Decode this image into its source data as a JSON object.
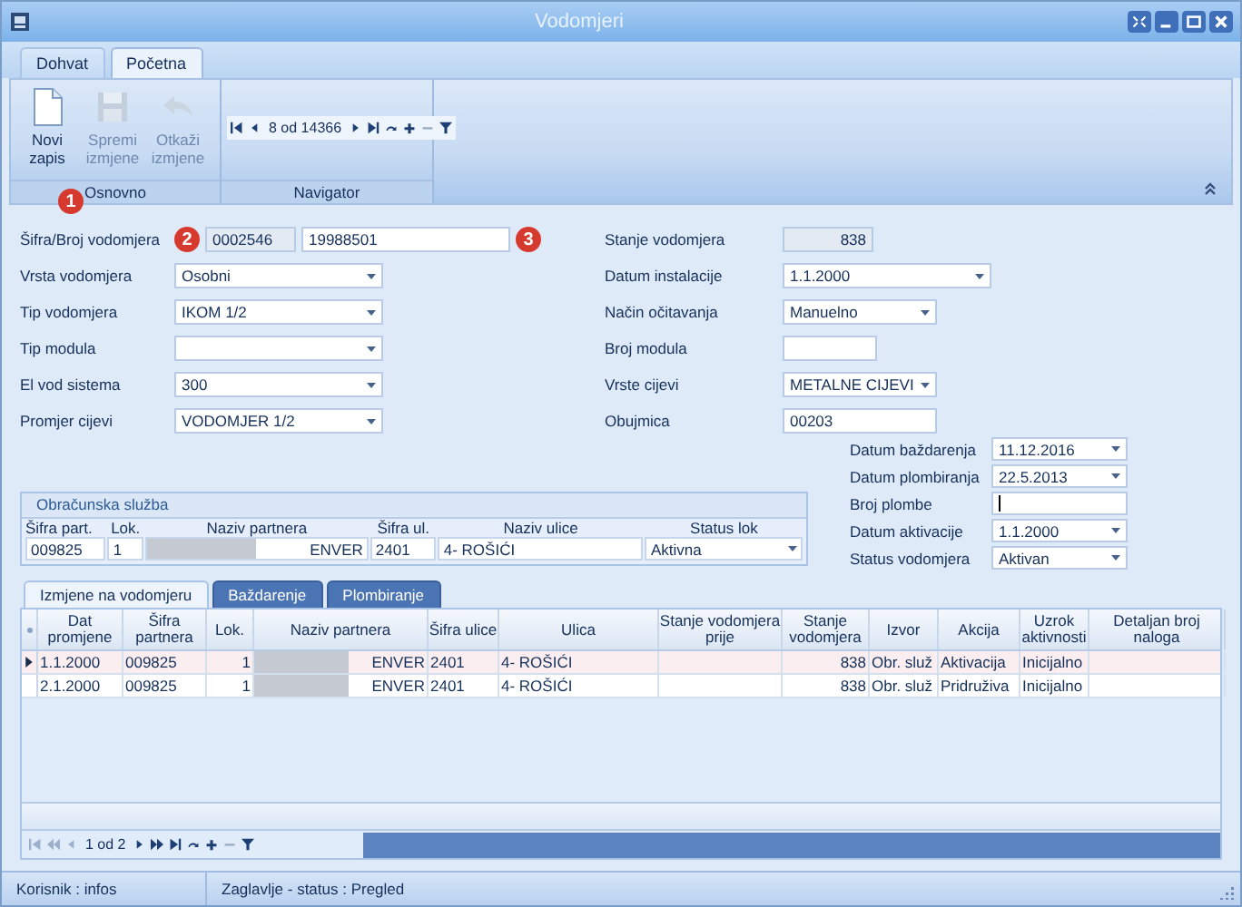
{
  "window": {
    "title": "Vodomjeri"
  },
  "ribbon_tabs": [
    {
      "label": "Dohvat",
      "selected": false
    },
    {
      "label": "Početna",
      "selected": true
    }
  ],
  "ribbon_groups": [
    {
      "kind": "buttons",
      "caption": "Osnovno",
      "callout": "1",
      "buttons": [
        {
          "label": "Novi zapis",
          "kind": "new",
          "disabled": false
        },
        {
          "label": "Spremi izmjene",
          "kind": "save",
          "disabled": true
        },
        {
          "label": "Otkaži izmjene",
          "kind": "undo",
          "disabled": true
        }
      ]
    },
    {
      "kind": "navigator",
      "caption": "Navigator",
      "position": "8 od 14366"
    }
  ],
  "form_left": [
    {
      "label": "Šifra/Broj vodomjera",
      "fields": [
        {
          "kind": "callout",
          "text": "2"
        },
        {
          "kind": "readonly",
          "value": "0002546"
        },
        {
          "kind": "text",
          "value": "19988501"
        },
        {
          "kind": "callout",
          "text": "3"
        }
      ]
    },
    {
      "label": "Vrsta vodomjera",
      "fields": [
        {
          "kind": "combo",
          "value": "Osobni"
        }
      ]
    },
    {
      "label": "Tip vodomjera",
      "fields": [
        {
          "kind": "combo",
          "value": "IKOM 1/2"
        }
      ]
    },
    {
      "label": "Tip modula",
      "fields": [
        {
          "kind": "combo"
        }
      ]
    },
    {
      "label": "El vod sistema",
      "fields": [
        {
          "kind": "combo",
          "value": "300"
        }
      ]
    },
    {
      "label": "Promjer cijevi",
      "fields": [
        {
          "kind": "combo",
          "value": "VODOMJER 1/2"
        }
      ]
    }
  ],
  "form_right": [
    {
      "label": "Stanje vodomjera",
      "fields": [
        {
          "kind": "readonly-number",
          "value": "838"
        }
      ]
    },
    {
      "label": "Datum instalacije",
      "fields": [
        {
          "kind": "combo",
          "value": "1.1.2000"
        }
      ]
    },
    {
      "label": "Način očitavanja",
      "fields": [
        {
          "kind": "combo",
          "value": "Manuelno"
        }
      ]
    },
    {
      "label": "Broj modula",
      "fields": [
        {
          "kind": "text"
        }
      ]
    },
    {
      "label": "Vrste cijevi",
      "fields": [
        {
          "kind": "combo",
          "value": "METALNE CIJEVI"
        }
      ]
    },
    {
      "label": "Obujmica",
      "fields": [
        {
          "kind": "text",
          "value": "00203"
        }
      ]
    }
  ],
  "billing_group": {
    "title": "Obračunska služba",
    "columns": [
      "Šifra part.",
      "Lok.",
      "Naziv partnera",
      "Šifra ul.",
      "Naziv ulice",
      "Status lok"
    ],
    "values": [
      {
        "kind": "text",
        "value": "009825"
      },
      {
        "kind": "number",
        "value": "1"
      },
      {
        "kind": "redacted",
        "value": "ENVER"
      },
      {
        "kind": "text",
        "value": "2401"
      },
      {
        "kind": "text",
        "value": "4- ROŠIĆI"
      },
      {
        "kind": "combo",
        "value": "Aktivna"
      }
    ]
  },
  "dates_group": [
    {
      "label": "Datum baždarenja",
      "kind": "combo",
      "value": "11.12.2016"
    },
    {
      "label": "Datum plombiranja",
      "kind": "combo",
      "value": "22.5.2013"
    },
    {
      "label": "Broj plombe",
      "kind": "text",
      "focused": true
    },
    {
      "label": "Datum aktivacije",
      "kind": "combo",
      "value": "1.1.2000"
    },
    {
      "label": "Status vodomjera",
      "kind": "combo",
      "value": "Aktivan"
    }
  ],
  "detail_tabs": [
    {
      "label": "Izmjene na vodomjeru",
      "selected": true
    },
    {
      "label": "Baždarenje",
      "selected": false
    },
    {
      "label": "Plombiranje",
      "selected": false
    }
  ],
  "table": {
    "columns": [
      "Dat promjene",
      "Šifra partnera",
      "Lok.",
      "Naziv partnera",
      "Šifra ulice",
      "Ulica",
      "Stanje vodomjera prije",
      "Stanje vodomjera",
      "Izvor",
      "Akcija",
      "Uzrok aktivnosti",
      "Detaljan broj naloga"
    ],
    "rows": [
      {
        "selected": true,
        "cells": [
          "1.1.2000",
          "009825",
          "1",
          "ENVER",
          "2401",
          "4- ROŠIĆI",
          "",
          "838",
          "Obr. služ",
          "Aktivacija",
          "Inicijalno",
          ""
        ]
      },
      {
        "selected": false,
        "cells": [
          "2.1.2000",
          "009825",
          "1",
          "ENVER",
          "2401",
          "4- ROŠIĆI",
          "",
          "838",
          "Obr. služ",
          "Pridruživa",
          "Inicijalno",
          ""
        ]
      }
    ]
  },
  "table_navigator": {
    "position": "1 od 2"
  },
  "status_bar": [
    "Korisnik : infos",
    "Zaglavlje - status : Pregled"
  ]
}
